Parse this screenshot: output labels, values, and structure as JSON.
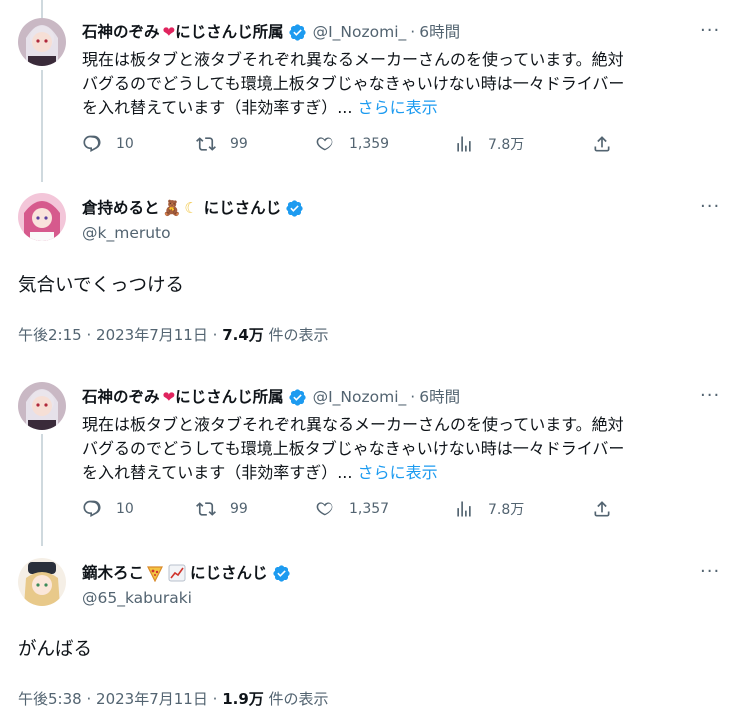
{
  "tweet1": {
    "display_name": "石神のぞみ",
    "affiliation": "にじさんじ所属",
    "handle": "@I_Nozomi_",
    "time": "6時間",
    "text_line1": "現在は板タブと液タブそれぞれ異なるメーカーさんのを使っています。絶対",
    "text_line2": "バグるのでどうしても環境上板タブじゃなきゃいけない時は一々ドライバー",
    "text_line3": "を入れ替えています（非効率すぎ）...",
    "show_more": "さらに表示",
    "replies": "10",
    "retweets": "99",
    "likes": "1,359",
    "views": "7.8万"
  },
  "reply1": {
    "display_name": "倉持めると",
    "affiliation": "にじさんじ",
    "handle": "@k_meruto",
    "text": "気合いでくっつける",
    "time": "午後2:15",
    "date": "2023年7月11日",
    "views": "7.4万",
    "views_suffix": "件の表示"
  },
  "tweet2": {
    "display_name": "石神のぞみ",
    "affiliation": "にじさんじ所属",
    "handle": "@I_Nozomi_",
    "time": "6時間",
    "text_line1": "現在は板タブと液タブそれぞれ異なるメーカーさんのを使っています。絶対",
    "text_line2": "バグるのでどうしても環境上板タブじゃなきゃいけない時は一々ドライバー",
    "text_line3": "を入れ替えています（非効率すぎ）...",
    "show_more": "さらに表示",
    "replies": "10",
    "retweets": "99",
    "likes": "1,357",
    "views": "7.8万"
  },
  "reply2": {
    "display_name": "鏑木ろこ",
    "affiliation": "にじさんじ",
    "handle": "@65_kaburaki",
    "text": "がんばる",
    "time": "午後5:38",
    "date": "2023年7月11日",
    "views": "1.9万",
    "views_suffix": "件の表示"
  },
  "separator": "·",
  "colors": {
    "accent": "#1d9bf0",
    "secondary_text": "#536471",
    "heart_emoji": "#e0245e"
  },
  "icons": [
    "verified-badge-icon",
    "more-icon",
    "reply-icon",
    "retweet-icon",
    "like-icon",
    "views-icon",
    "share-icon"
  ]
}
